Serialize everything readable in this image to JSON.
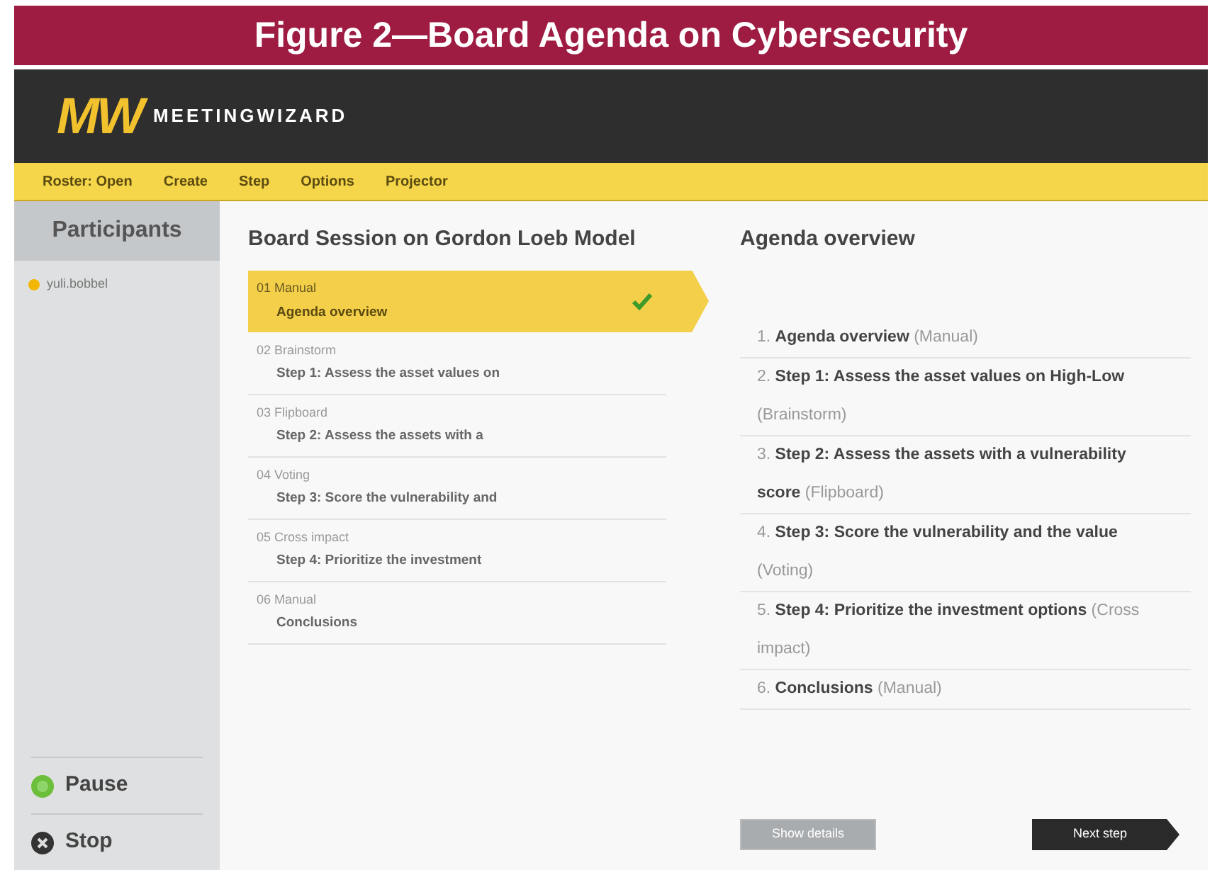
{
  "figure_title": "Figure 2—Board Agenda on Cybersecurity",
  "app": {
    "logo": "MW",
    "name": "MEETINGWIZARD"
  },
  "toolbar": [
    "Roster: Open",
    "Create",
    "Step",
    "Options",
    "Projector"
  ],
  "sidebar": {
    "title": "Participants",
    "participants": [
      {
        "name": "yuli.bobbel",
        "color": "#f2b705"
      }
    ],
    "controls": [
      {
        "label": "Pause",
        "kind": "pause"
      },
      {
        "label": "Stop",
        "kind": "stop"
      }
    ]
  },
  "session": {
    "title": "Board Session on Gordon Loeb Model",
    "steps": [
      {
        "method": "01 Manual",
        "title": "Agenda overview",
        "selected": true,
        "done": true
      },
      {
        "method": "02 Brainstorm",
        "title": "Step 1: Assess the asset values on",
        "selected": false,
        "done": false
      },
      {
        "method": "03 Flipboard",
        "title": "Step 2: Assess the assets with a",
        "selected": false,
        "done": false
      },
      {
        "method": "04 Voting",
        "title": "Step 3: Score the vulnerability and",
        "selected": false,
        "done": false
      },
      {
        "method": "05 Cross impact",
        "title": "Step 4: Prioritize the investment",
        "selected": false,
        "done": false
      },
      {
        "method": "06 Manual",
        "title": "Conclusions",
        "selected": false,
        "done": false
      }
    ]
  },
  "overview": {
    "title": "Agenda overview",
    "items": [
      {
        "number": "1.",
        "title": "Agenda overview",
        "method": "(Manual)"
      },
      {
        "number": "2.",
        "title": "Step 1: Assess the asset values on High-Low",
        "method": "(Brainstorm)"
      },
      {
        "number": "3.",
        "title": "Step 2: Assess the assets with a vulnerability score",
        "method": "(Flipboard)"
      },
      {
        "number": "4.",
        "title": "Step 3: Score the vulnerability and the value",
        "method": "(Voting)"
      },
      {
        "number": "5.",
        "title": "Step 4: Prioritize the investment options",
        "method": "(Cross impact)"
      },
      {
        "number": "6.",
        "title": "Conclusions",
        "method": "(Manual)"
      }
    ]
  },
  "buttons": [
    {
      "label": "Show details",
      "kind": "secondary",
      "disabled": true
    },
    {
      "label": "Next step",
      "kind": "primary",
      "disabled": false
    }
  ]
}
